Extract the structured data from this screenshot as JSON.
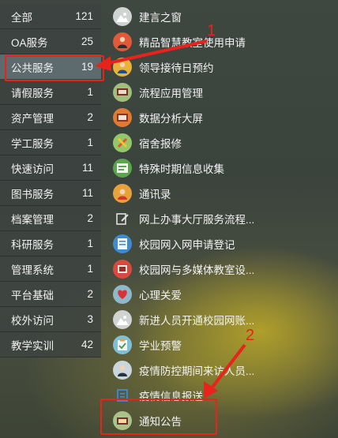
{
  "categories": [
    {
      "label": "全部",
      "count": "121"
    },
    {
      "label": "OA服务",
      "count": "25"
    },
    {
      "label": "公共服务",
      "count": "19"
    },
    {
      "label": "请假服务",
      "count": "1"
    },
    {
      "label": "资产管理",
      "count": "2"
    },
    {
      "label": "学工服务",
      "count": "1"
    },
    {
      "label": "快速访问",
      "count": "11"
    },
    {
      "label": "图书服务",
      "count": "11"
    },
    {
      "label": "档案管理",
      "count": "2"
    },
    {
      "label": "科研服务",
      "count": "1"
    },
    {
      "label": "管理系统",
      "count": "1"
    },
    {
      "label": "平台基础",
      "count": "2"
    },
    {
      "label": "校外访问",
      "count": "3"
    },
    {
      "label": "教学实训",
      "count": "42"
    }
  ],
  "apps": [
    {
      "label": "建言之窗",
      "icon": "landscape-icon"
    },
    {
      "label": "精品智慧教室使用申请",
      "icon": "teacher-icon"
    },
    {
      "label": "领导接待日预约",
      "icon": "person-icon"
    },
    {
      "label": "流程应用管理",
      "icon": "monitor-icon"
    },
    {
      "label": "数据分析大屏",
      "icon": "screen-icon"
    },
    {
      "label": "宿舍报修",
      "icon": "tools-icon"
    },
    {
      "label": "特殊时期信息收集",
      "icon": "form-icon"
    },
    {
      "label": "通讯录",
      "icon": "contact-icon"
    },
    {
      "label": "网上办事大厅服务流程...",
      "icon": "pen-icon"
    },
    {
      "label": "校园网入网申请登记",
      "icon": "document-icon"
    },
    {
      "label": "校园网与多媒体教室设...",
      "icon": "equipment-icon"
    },
    {
      "label": "心理关爱",
      "icon": "heart-icon"
    },
    {
      "label": "新进人员开通校园网账...",
      "icon": "landscape-icon"
    },
    {
      "label": "学业预警",
      "icon": "clipboard-icon"
    },
    {
      "label": "疫情防控期间来访人员...",
      "icon": "visitor-icon"
    },
    {
      "label": "疫情信息报送",
      "icon": "report-icon"
    },
    {
      "label": "通知公告",
      "icon": "notice-icon"
    }
  ],
  "annotations": {
    "first": "1",
    "second": "2"
  },
  "colors": {
    "highlight": "#e8231b"
  }
}
